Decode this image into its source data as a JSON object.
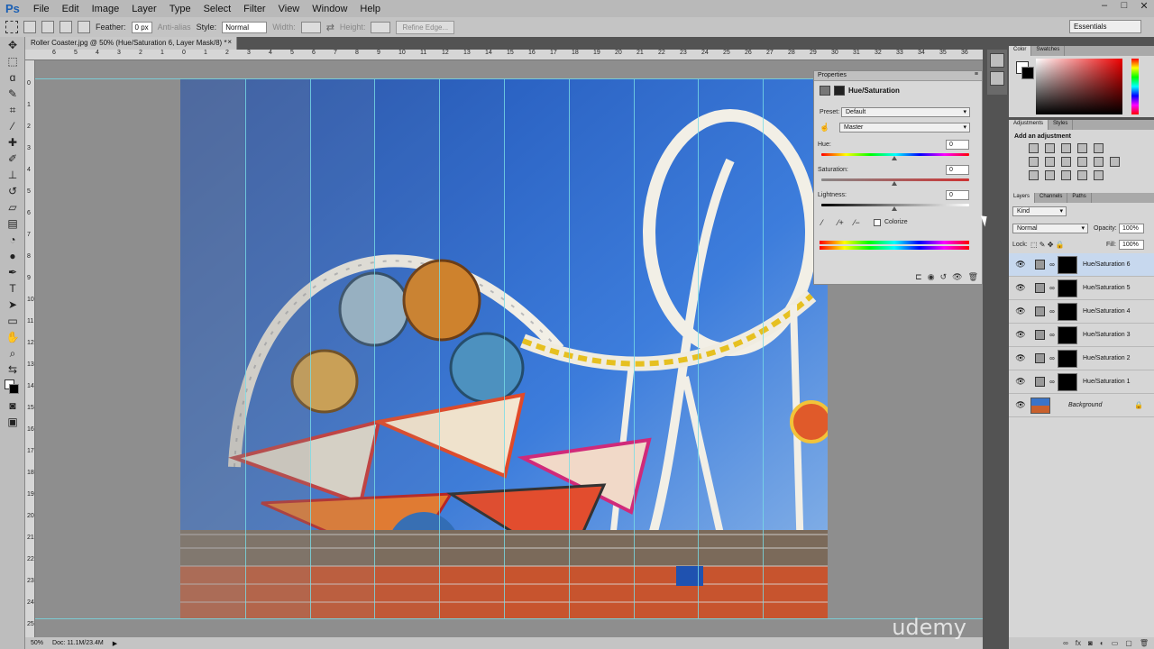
{
  "app": {
    "logo": "Ps"
  },
  "menu": [
    "File",
    "Edit",
    "Image",
    "Layer",
    "Type",
    "Select",
    "Filter",
    "View",
    "Window",
    "Help"
  ],
  "window_controls": [
    "–",
    "□",
    "✕"
  ],
  "options_bar": {
    "feather_label": "Feather:",
    "feather_value": "0 px",
    "antialias_label": "Anti-alias",
    "style_label": "Style:",
    "style_value": "Normal",
    "width_label": "Width:",
    "height_label": "Height:",
    "refine_edge": "Refine Edge...",
    "workspace": "Essentials"
  },
  "document": {
    "tab_title": "Roller Coaster.jpg @ 50% (Hue/Saturation 6, Layer Mask/8) *",
    "tab_close": "×",
    "zoom": "50%",
    "doc_info": "Doc: 11.1M/23.4M",
    "ruler_h": [
      "6",
      "5",
      "4",
      "3",
      "2",
      "1",
      "0",
      "1",
      "2",
      "3",
      "4",
      "5",
      "6",
      "7",
      "8",
      "9",
      "10",
      "11",
      "12",
      "13",
      "14",
      "15",
      "16",
      "17",
      "18",
      "19",
      "20",
      "21",
      "22",
      "23",
      "24",
      "25",
      "26",
      "27",
      "28",
      "29",
      "30",
      "31",
      "32",
      "33",
      "34",
      "35",
      "36"
    ],
    "ruler_v": [
      "0",
      "1",
      "2",
      "3",
      "4",
      "5",
      "6",
      "7",
      "8",
      "9",
      "10",
      "11",
      "12",
      "13",
      "14",
      "15",
      "16",
      "17",
      "18",
      "19",
      "20",
      "21",
      "22",
      "23",
      "24",
      "25"
    ],
    "guide_count": 10,
    "band_opacity": [
      0.45,
      0.32,
      0.2,
      0.1,
      0.04,
      0,
      0,
      0,
      0,
      0
    ]
  },
  "properties_panel": {
    "tab": "Properties",
    "title": "Hue/Saturation",
    "preset_label": "Preset:",
    "preset_value": "Default",
    "channel_value": "Master",
    "hue_label": "Hue:",
    "hue_value": "0",
    "saturation_label": "Saturation:",
    "saturation_value": "0",
    "lightness_label": "Lightness:",
    "lightness_value": "0",
    "colorize_label": "Colorize"
  },
  "color_panel": {
    "tabs": [
      "Color",
      "Swatches"
    ]
  },
  "adjustments_panel": {
    "tabs": [
      "Adjustments",
      "Styles"
    ],
    "heading": "Add an adjustment"
  },
  "layers_panel": {
    "tabs": [
      "Layers",
      "Channels",
      "Paths"
    ],
    "kind_filter": "Kind",
    "blend_mode": "Normal",
    "opacity_label": "Opacity:",
    "opacity_value": "100%",
    "lock_label": "Lock:",
    "fill_label": "Fill:",
    "fill_value": "100%",
    "layers": [
      {
        "name": "Hue/Saturation 6",
        "selected": true
      },
      {
        "name": "Hue/Saturation 5",
        "selected": false
      },
      {
        "name": "Hue/Saturation 4",
        "selected": false
      },
      {
        "name": "Hue/Saturation 3",
        "selected": false
      },
      {
        "name": "Hue/Saturation 2",
        "selected": false
      },
      {
        "name": "Hue/Saturation 1",
        "selected": false
      }
    ],
    "background_layer": "Background"
  },
  "watermark": "udemy"
}
